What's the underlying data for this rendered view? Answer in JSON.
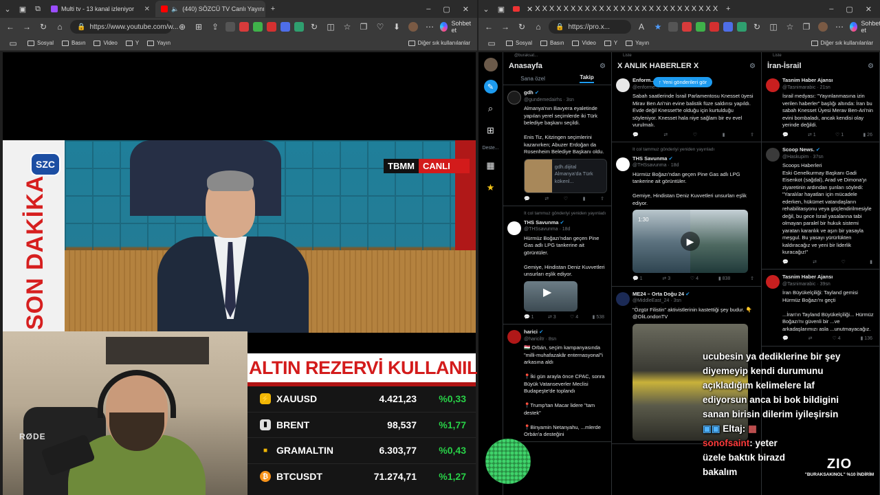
{
  "left": {
    "tabs": [
      {
        "label": "Multi tv - 13 kanal izleniyor",
        "active": false,
        "color": "#9b4dff"
      },
      {
        "label": "(440) SÖZCÜ TV Canlı Yayını",
        "active": true,
        "color": "#ff0000"
      }
    ],
    "url": "https://www.youtube.com/w...",
    "copilot_label": "Sohbet et",
    "bookmarks": [
      "Sosyal",
      "Basın",
      "Video",
      "Y",
      "Yayın"
    ],
    "bookmarks_right": "Diğer sık kullanılanlar",
    "video": {
      "logo": "SZC",
      "side_text": "SON DAKİKA",
      "tbmm": "TBMM",
      "live": "CANLI",
      "banner": "ALTIN REZERVİ KULLANILACAK",
      "mic_brand": "RØDE",
      "ticker": [
        {
          "name": "XAUUSD",
          "price": "4.421,23",
          "change": "%0,33",
          "icon_color": "#f2b705",
          "icon": "⚡"
        },
        {
          "name": "BRENT",
          "price": "98,537",
          "change": "%1,77",
          "icon_color": "#dddddd",
          "icon": "▮"
        },
        {
          "name": "GRAMALTIN",
          "price": "6.303,77",
          "change": "%0,43",
          "icon_color": "#f2b705",
          "icon": "■"
        },
        {
          "name": "BTCUSDT",
          "price": "71.274,71",
          "change": "%1,27",
          "icon_color": "#f7931a",
          "icon": "₿"
        }
      ]
    }
  },
  "right": {
    "url": "https://pro.x...",
    "copilot_label": "Sohbet et",
    "bookmarks": [
      "Sosyal",
      "Basın",
      "Video",
      "Y",
      "Yayın"
    ],
    "bookmarks_right": "Diğer sık kullanılanlar",
    "nav_more": "Deste...",
    "columns": {
      "c1": {
        "small": "@buraksat...",
        "title": "Anasayfa",
        "tabs": [
          "Sana özel",
          "Takip"
        ],
        "tweets": [
          {
            "rt": "",
            "name": "gdh",
            "handle": "@gundemedairhs · 3sn",
            "text": "Almanya'nın Bavyera eyaletinde yapılan yerel seçimlerde iki Türk belediye başkanı seçildi.\n\nEnis Tiz, Kitzingen seçimlerini kazanırken; Abuzer Erdoğan da Rosenheim Belediye Başkanı oldu.",
            "card": "gdh.dijital\nAlmanya'da Türk kökenl..."
          },
          {
            "rt": "It col tammuz gönderiyi yeniden yayınladı",
            "name": "THS Savunma",
            "handle": "@THSsavunma · 18d",
            "text": "Hürmüz Boğazı'ndan geçen Pine Gas adlı LPG tankerine ait görüntüler.\n\nGemiye, Hindistan Deniz Kuvvetleri unsurları eşlik ediyor.",
            "stats": [
              "1",
              "3",
              "4",
              "538"
            ]
          },
          {
            "rt": "",
            "name": "harici",
            "handle": "@hariciltr · 8sn",
            "text": "🇭🇺 Orbán, seçim kampanyasında \"milli-muhafazakâr enternasyonal\"i arkasına aldı\n\n📍İki gün arayla önce CPAC, sonra Büyük Vatanseverler Meclisi Budapeşte'de toplandı\n\n📍Trump'tan Macar lidere \"tam destek\"\n\n📍Binyamin Netanyahu, ...mlerde Orbán'a desteğini"
          }
        ]
      },
      "c2": {
        "small": "Liste",
        "title": "X ANLIK HABERLER X",
        "new_posts": "Yeni gönderileri gör",
        "tweets": [
          {
            "rt": "",
            "name": "Enform...",
            "handle": "@enforme...",
            "text": "Sabah saatlerinde İsrail Parlamentosu Knesset üyesi Mirav Ben Ari'nin evine balistik füze saldırısı yapıldı. Evde değil Knesset'te olduğu için kurtulduğu söyleniyor. Knesset hala niye sağlam bir ev evel vurulmalı."
          },
          {
            "rt": "It col tammuz gönderiyi yeniden yayınladı",
            "name": "THS Savunma",
            "handle": "@THSsavunma · 18d",
            "text": "Hürmüz Boğazı'ndan geçen Pine Gas adlı LPG tankerine ait görüntüler.\n\nGemiye, Hindistan Deniz Kuvvetleri unsurları eşlik ediyor.",
            "duration": "1:30",
            "stats": [
              "1",
              "3",
              "4",
              "838"
            ]
          },
          {
            "rt": "",
            "name": "ME24 – Orta Doğu 24",
            "handle": "@MiddleEast_24 · 3sn",
            "text": "\"Özgür Filistin\" aktivistlerinin kastettiği şey budur. 👇\n@OliLondonTV"
          }
        ]
      },
      "c3": {
        "small": "Liste",
        "title": "İran-İsrail",
        "tweets": [
          {
            "rt": "",
            "name": "Tasnim Haber Ajansı",
            "handle": "@Tasnimarabic · 21sn",
            "text": "İsrail medyası: \"Yayınlanmasına izin verilen haberler\" başlığı altında: İran bu sabah Knesset Üyesi Merav Ben-Ari'nin evini bombaladı, ancak kendisi olay yerinde değildi.",
            "stats": [
              "1",
              "1",
              "26"
            ]
          },
          {
            "rt": "",
            "name": "Scoop News.",
            "handle": "@Haskupim · 37sn",
            "text": "Scoops Haberleri\nEski Genelkurmay Başkanı Gadi Eisenkot (sağdal), Arad ve Dimona'yı ziyaretinin ardından şunları söyledi: \"Yaralılar hayatları için mücadele ederken, hükümet vatandaşların rehabilitasyonu veya güçlendirilmesiyle değil, bu gece İsrail yasalarına tabi olmayan paralel bir hukuk sistemi yaratan karanlık ve aşırı bir yasayla meşgul. Bu yasayı yürürlükten kaldıracağız ve yeni bir liderlik kuracağız!\""
          },
          {
            "rt": "",
            "name": "Tasnim Haber Ajansı",
            "handle": "@Tasnimarabic · 39sn",
            "text": "İran Büyükelçiliği: Tayland gemisi Hürmüz Boğazı'nı geçti\n\n...İran'ın Tayland Büyükelçiliği... Hürmüz Boğazı'nı güvenli bir ...ve arkadaşlarımızı asla ...unutmayacağız.",
            "stats": [
              "4",
              "136"
            ]
          }
        ]
      }
    },
    "overlay": {
      "lines": [
        "ucubesin ya dediklerine bir şey",
        "diyemeyip kendi durumunu",
        "açıkladığım kelimelere laf",
        "ediyorsun anca bi bok bildigini",
        "sanan birisin dilerim iyileşirsin"
      ],
      "user1": "Eltaj:",
      "user2": "sonofsaint",
      "line2": "yeter",
      "line3": "üzele baktık birazd",
      "line4": "bakalım"
    },
    "zio": {
      "big": "ZIO",
      "small": "\"BURAKSAKINOL\" %10 İNDİRİM"
    }
  }
}
